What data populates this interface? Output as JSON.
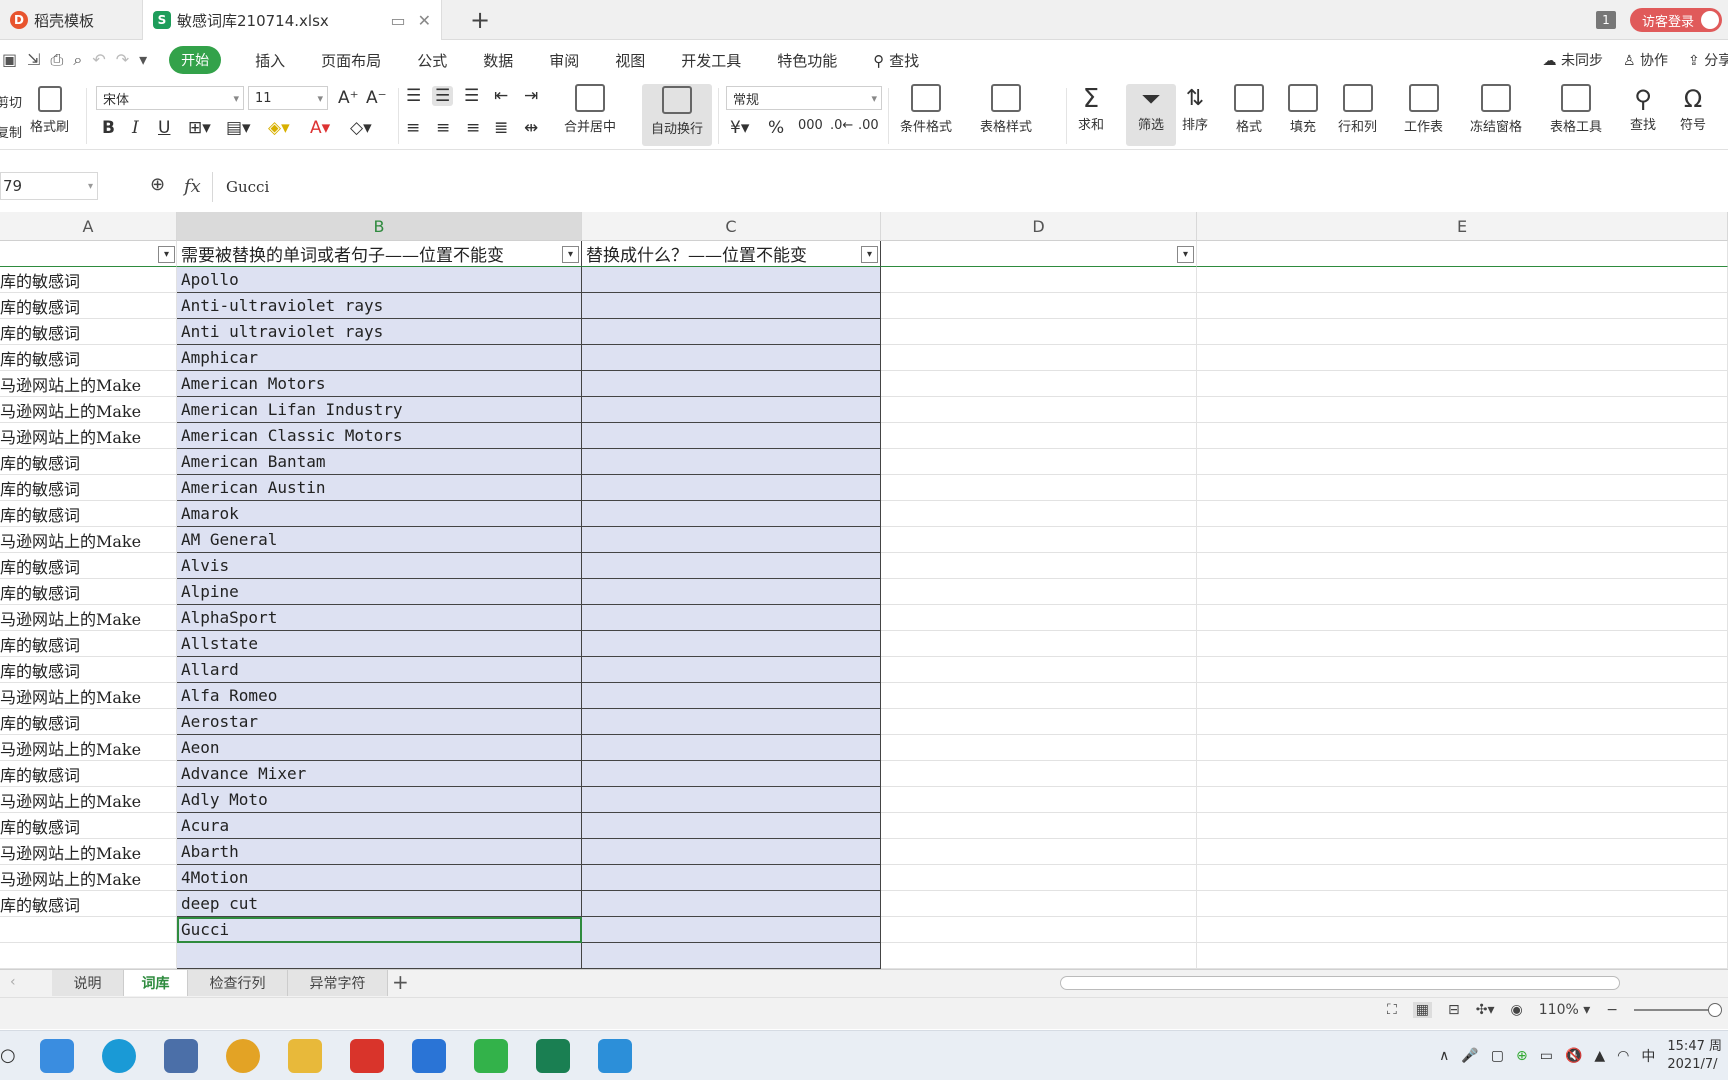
{
  "titlebar": {
    "tab1": "稻壳模板",
    "tab2": "敏感词库210714.xlsx",
    "window_count": "1",
    "login": "访客登录"
  },
  "menu": {
    "items": [
      "开始",
      "插入",
      "页面布局",
      "公式",
      "数据",
      "审阅",
      "视图",
      "开发工具",
      "特色功能"
    ],
    "search": "查找",
    "sync": "未同步",
    "collab": "协作",
    "share": "分享"
  },
  "ribbon": {
    "cut": "剪切",
    "copy": "复制",
    "format_painter": "格式刷",
    "font": "宋体",
    "size": "11",
    "merge": "合并居中",
    "wrap": "自动换行",
    "number_format": "常规",
    "cond_format": "条件格式",
    "table_style": "表格样式",
    "sum": "求和",
    "filter": "筛选",
    "sort": "排序",
    "format": "格式",
    "fill": "填充",
    "rowcol": "行和列",
    "sheet": "工作表",
    "freeze": "冻结窗格",
    "table_tools": "表格工具",
    "find": "查找",
    "symbol": "符号"
  },
  "formula": {
    "namebox": "79",
    "fx": "fx",
    "value": "Gucci"
  },
  "columns": [
    "A",
    "B",
    "C",
    "D",
    "E"
  ],
  "header_row": {
    "b": "需要被替换的单词或者句子——位置不能变",
    "c": "替换成什么？——位置不能变"
  },
  "rows": [
    {
      "a": "库的敏感词",
      "b": "Apollo"
    },
    {
      "a": "库的敏感词",
      "b": "Anti-ultraviolet rays"
    },
    {
      "a": "库的敏感词",
      "b": "Anti ultraviolet rays"
    },
    {
      "a": "库的敏感词",
      "b": "Amphicar"
    },
    {
      "a": "马逊网站上的Make",
      "b": "American Motors"
    },
    {
      "a": "马逊网站上的Make",
      "b": "American Lifan Industry"
    },
    {
      "a": "马逊网站上的Make",
      "b": "American Classic Motors"
    },
    {
      "a": "库的敏感词",
      "b": "American Bantam"
    },
    {
      "a": "库的敏感词",
      "b": "American Austin"
    },
    {
      "a": "库的敏感词",
      "b": "Amarok"
    },
    {
      "a": "马逊网站上的Make",
      "b": "AM General"
    },
    {
      "a": "库的敏感词",
      "b": "Alvis"
    },
    {
      "a": "库的敏感词",
      "b": "Alpine"
    },
    {
      "a": "马逊网站上的Make",
      "b": "AlphaSport"
    },
    {
      "a": "库的敏感词",
      "b": "Allstate"
    },
    {
      "a": "库的敏感词",
      "b": "Allard"
    },
    {
      "a": "马逊网站上的Make",
      "b": "Alfa Romeo"
    },
    {
      "a": "库的敏感词",
      "b": "Aerostar"
    },
    {
      "a": "马逊网站上的Make",
      "b": "Aeon"
    },
    {
      "a": "库的敏感词",
      "b": "Advance Mixer"
    },
    {
      "a": "马逊网站上的Make",
      "b": "Adly Moto"
    },
    {
      "a": "库的敏感词",
      "b": "Acura"
    },
    {
      "a": "马逊网站上的Make",
      "b": "Abarth"
    },
    {
      "a": "马逊网站上的Make",
      "b": "4Motion"
    },
    {
      "a": "库的敏感词",
      "b": "deep cut"
    },
    {
      "a": "",
      "b": "Gucci"
    },
    {
      "a": "",
      "b": ""
    }
  ],
  "sheets": [
    "说明",
    "词库",
    "检查行列",
    "异常字符"
  ],
  "active_sheet": 1,
  "status": {
    "zoom": "110%"
  },
  "clock": {
    "time": "15:47 周",
    "date": "2021/7/"
  },
  "tray": {
    "ime": "中"
  },
  "colors": {
    "accent": "#33a24a",
    "selection": "#dde1f2",
    "login": "#e05a5a"
  }
}
